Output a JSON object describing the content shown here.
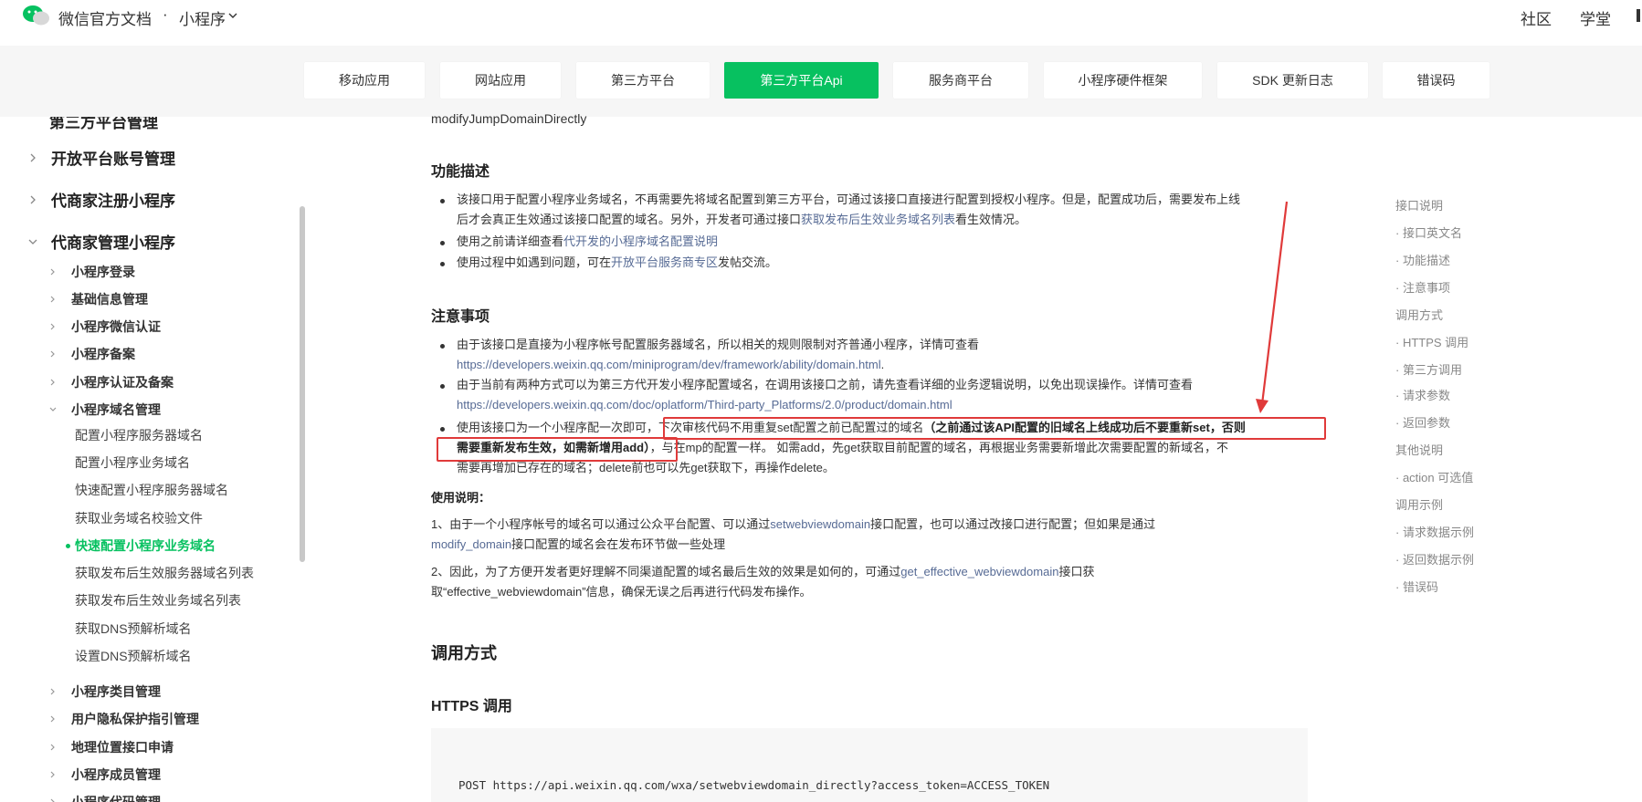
{
  "header": {
    "brand": "微信官方文档",
    "separator": "·",
    "product": "小程序",
    "nav": [
      "社区",
      "学堂"
    ]
  },
  "tabs": [
    {
      "label": "移动应用",
      "active": false
    },
    {
      "label": "网站应用",
      "active": false
    },
    {
      "label": "第三方平台",
      "active": false
    },
    {
      "label": "第三方平台Api",
      "active": true
    },
    {
      "label": "服务商平台",
      "active": false
    },
    {
      "label": "小程序硬件框架",
      "active": false
    },
    {
      "label": "SDK 更新日志",
      "active": false
    },
    {
      "label": "错误码",
      "active": false
    }
  ],
  "sidebar": {
    "clipped_top": "第三方平台管理",
    "level1": [
      "开放平台账号管理",
      "代商家注册小程序",
      "代商家管理小程序"
    ],
    "level2_top": [
      "小程序登录",
      "基础信息管理",
      "小程序微信认证",
      "小程序备案",
      "小程序认证及备案",
      "小程序域名管理"
    ],
    "level3": [
      {
        "label": "配置小程序服务器域名",
        "active": false
      },
      {
        "label": "配置小程序业务域名",
        "active": false
      },
      {
        "label": "快速配置小程序服务器域名",
        "active": false
      },
      {
        "label": "获取业务域名校验文件",
        "active": false
      },
      {
        "label": "快速配置小程序业务域名",
        "active": true
      },
      {
        "label": "获取发布后生效服务器域名列表",
        "active": false
      },
      {
        "label": "获取发布后生效业务域名列表",
        "active": false
      },
      {
        "label": "获取DNS预解析域名",
        "active": false
      },
      {
        "label": "设置DNS预解析域名",
        "active": false
      }
    ],
    "level2_bottom": [
      "小程序类目管理",
      "用户隐私保护指引管理",
      "地理位置接口申请",
      "小程序成员管理",
      "小程序代码管理"
    ]
  },
  "content": {
    "clipped_top": "modifyJumpDomainDirectly",
    "feature_title": "功能描述",
    "feature_b1_l1": "该接口用于配置小程序业务域名，不再需要先将域名配置到第三方平台，可通过该接口直接进行配置到授权小程序。但是，配置成功后，需要发布上线",
    "feature_b1_l2a": "后才会真正生效通过该接口配置的域名。另外，开发者可通过接口",
    "feature_b1_link": "获取发布后生效业务域名列表",
    "feature_b1_l2b": "看生效情况。",
    "feature_b2_a": "使用之前请详细查看",
    "feature_b2_link": "代开发的小程序域名配置说明",
    "feature_b3_a": "使用过程中如遇到问题，可在",
    "feature_b3_link": "开放平台服务商专区",
    "feature_b3_b": "发帖交流。",
    "notes_title": "注意事项",
    "note1_l1": "由于该接口是直接为小程序帐号配置服务器域名，所以相关的规则限制对齐普通小程序，详情可查看",
    "note1_link": "https://developers.weixin.qq.com/miniprogram/dev/framework/ability/domain.html",
    "note1_end": ".",
    "note2_l1": "由于当前有两种方式可以为第三方代开发小程序配置域名，在调用该接口之前，请先查看详细的业务逻辑说明，以免出现误操作。详情可查看",
    "note2_link": "https://developers.weixin.qq.com/doc/oplatform/Third-party_Platforms/2.0/product/domain.html",
    "note3_a": "使用该接口为一个小程序配一次即可，",
    "note3_b": "下次审核代码不用重复set配置之前已配置过的域名",
    "note3_strong1": "（之前通过该API配置的旧域名上线成功后不要重新set，否则",
    "note3_strong2": "需要重新发布生效，如需新增用add）",
    "note3_c": "，与在mp的配置一样。 如需add，先get获取目前配置的域名，再根据业务需要新增此次需要配置的新域名，不",
    "note3_d": "需要再增加已存在的域名；delete前也可以先get获取下，再操作delete。",
    "usage_title": "使用说明：",
    "usage1_a": "1、由于一个小程序帐号的域名可以通过公众平台配置、可以通过",
    "usage1_link1": "setwebviewdomain",
    "usage1_b": "接口配置，也可以通过改接口进行配置；但如果是通过",
    "usage1_link2": "modify_domain",
    "usage1_c": "接口配置的域名会在发布环节做一些处理",
    "usage2_a": "2、因此，为了方便开发者更好理解不同渠道配置的域名最后生效的效果是如何的，可通过",
    "usage2_link": "get_effective_webviewdomain",
    "usage2_b": "接口获",
    "usage2_c": "取“effective_webviewdomain”信息，确保无误之后再进行代码发布操作。",
    "call_title": "调用方式",
    "https_title": "HTTPS 调用",
    "code": "POST https://api.weixin.qq.com/wxa/setwebviewdomain_directly?access_token=ACCESS_TOKEN"
  },
  "toc": [
    {
      "label": "接口说明",
      "level": 1
    },
    {
      "label": "· 接口英文名",
      "level": 2
    },
    {
      "label": "· 功能描述",
      "level": 2
    },
    {
      "label": "· 注意事项",
      "level": 2
    },
    {
      "label": "调用方式",
      "level": 1
    },
    {
      "label": "· HTTPS 调用",
      "level": 2
    },
    {
      "label": "· 第三方调用",
      "level": 2
    },
    {
      "label": "· 请求参数",
      "level": 2
    },
    {
      "label": "· 返回参数",
      "level": 2
    },
    {
      "label": "其他说明",
      "level": 1
    },
    {
      "label": "· action 可选值",
      "level": 2
    },
    {
      "label": "调用示例",
      "level": 1
    },
    {
      "label": "· 请求数据示例",
      "level": 2
    },
    {
      "label": "· 返回数据示例",
      "level": 2
    },
    {
      "label": "· 错误码",
      "level": 2
    }
  ],
  "colors": {
    "accent": "#07c160",
    "link": "#576b95",
    "annotation": "#e03a3a"
  }
}
